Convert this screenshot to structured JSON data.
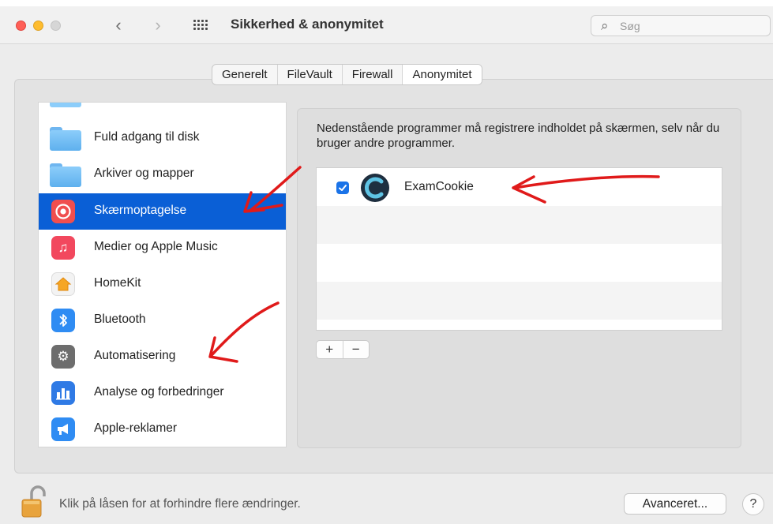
{
  "window": {
    "title": "Sikkerhed & anonymitet",
    "search_placeholder": "Søg"
  },
  "tabs": [
    {
      "label": "Generelt",
      "active": false
    },
    {
      "label": "FileVault",
      "active": false
    },
    {
      "label": "Firewall",
      "active": false
    },
    {
      "label": "Anonymitet",
      "active": true
    }
  ],
  "sidebar": {
    "items": [
      {
        "label": "Fuld adgang til disk",
        "icon": "folder-icon",
        "selected": false
      },
      {
        "label": "Arkiver og mapper",
        "icon": "folder-icon",
        "selected": false
      },
      {
        "label": "Skærmoptagelse",
        "icon": "screen-recording-icon",
        "selected": true
      },
      {
        "label": "Medier og Apple Music",
        "icon": "music-note-icon",
        "selected": false
      },
      {
        "label": "HomeKit",
        "icon": "home-icon",
        "selected": false
      },
      {
        "label": "Bluetooth",
        "icon": "bluetooth-icon",
        "selected": false
      },
      {
        "label": "Automatisering",
        "icon": "gear-icon",
        "selected": false
      },
      {
        "label": "Analyse og forbedringer",
        "icon": "bar-chart-icon",
        "selected": false
      },
      {
        "label": "Apple-reklamer",
        "icon": "megaphone-icon",
        "selected": false
      }
    ]
  },
  "content": {
    "description": "Nedenstående programmer må registrere indholdet på skærmen, selv når du bruger andre programmer.",
    "apps": [
      {
        "name": "ExamCookie",
        "checked": true
      }
    ],
    "add_label": "+",
    "remove_label": "−"
  },
  "footer": {
    "lock_text": "Klik på låsen for at forhindre flere ændringer.",
    "advanced_button": "Avanceret...",
    "help_button": "?"
  },
  "colors": {
    "selection": "#0a5fd6",
    "checkbox": "#1a73e8",
    "annotation": "#e01a1a"
  }
}
